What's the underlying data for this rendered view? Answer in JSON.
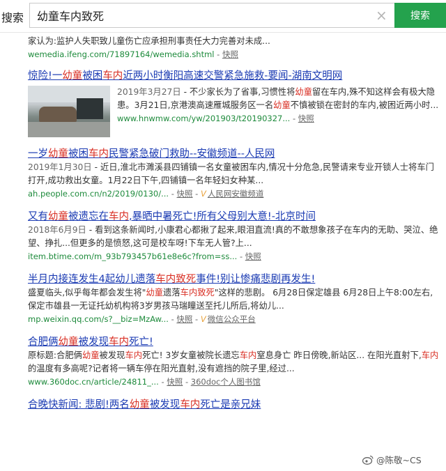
{
  "search": {
    "site_label": "搜索",
    "query": "幼童车内致死",
    "clear_icon": "clear-icon",
    "button_label": "搜索"
  },
  "results": [
    {
      "desc": "家认为:监护人失职致儿童伤亡应承担刑事责任大力完善对未成...",
      "url": "wemedia.ifeng.com/71897164/wemedia.shtml",
      "sep": " - ",
      "snapshot": "快照"
    },
    {
      "title_parts": [
        "惊险!一",
        "幼童",
        "被困",
        "车内",
        "近两小时衡阳高速交警紧急施救-要闻-湖南文明网"
      ],
      "desc_parts": [
        "2019年3月27日",
        " - 不少家长为了省事,习惯性将",
        "幼童",
        "留在车内,殊不知这样会有极大隐患。3月21日,京港澳高速雁城服务区一名",
        "幼童",
        "不慎被锁在密封的车内,被困近两小时..."
      ],
      "url": "www.hnwmw.com/yw/201903/t20190327...",
      "sep": " - ",
      "snapshot": "快照"
    },
    {
      "title_parts": [
        "一岁",
        "幼童",
        "被困",
        "车内",
        "民警紧急破门救助--安徽频道--人民网"
      ],
      "desc_parts": [
        "2019年1月30日",
        " - 近日,淮北市濉溪县四铺镇一名女童被困车内,情况十分危急,民警请来专业开锁人士将车门打开,成功救出女童。1月22日下午,四铺镇一名年轻妇女种某..."
      ],
      "url": "ah.people.com.cn/n2/2019/0130/...",
      "sep": " - ",
      "snapshot": "快照",
      "source_mark": "V",
      "source": "人民网安徽频道"
    },
    {
      "title_parts": [
        "又有",
        "幼童",
        "被遗忘在",
        "车内",
        ",暴晒中暑死亡!所有父母别大意!-北京时间"
      ],
      "desc_parts": [
        "2018年6月9日",
        " - 看到这条新闻时,小康君心都揪了起来,眼泪直流!真的不敢想象孩子在车内的无助、哭泣、绝望、挣扎...但更多的是愤怒,这可是校车呀!下车无人管?上..."
      ],
      "url": "item.btime.com/m_93b793457b61e8e6c?from=ss...",
      "sep": " - ",
      "snapshot": "快照"
    },
    {
      "title_parts": [
        "半月内接连发生4起幼儿遗落",
        "车内致死",
        "事件!别让惨痛悲剧再发生!"
      ],
      "desc_parts": [
        "盛夏临头,似乎每年都会发生将\"",
        "幼童",
        "遗落",
        "车内致死",
        "\"这样的悲剧。 6月28日保定雄县 6月28日上午8:00左右,保定市雄县一无证托幼机构将3岁男孩马瑞瞳送至托儿所后,将幼儿..."
      ],
      "url": "mp.weixin.qq.com/s?__biz=MzAw...",
      "sep": " - ",
      "snapshot": "快照",
      "source_mark": "V",
      "source": "微信公众平台"
    },
    {
      "title_parts": [
        "合肥俩",
        "幼童",
        "被发现",
        "车内",
        "死亡!"
      ],
      "desc_parts": [
        "原标题:合肥俩",
        "幼童",
        "被发现",
        "车内",
        "死亡! 3岁女童被院长遗忘",
        "车内",
        "窒息身亡 昨日傍晚,新站区... 在阳光直射下,",
        "车内",
        "的温度有多高呢?记者将一辆车停在阳光直射,没有遮挡的院子里,经过..."
      ],
      "url": "www.360doc.cn/article/24811_...",
      "sep": " - ",
      "snapshot": "快照",
      "source": "360doc个人图书馆"
    },
    {
      "title_parts": [
        "合晚快新闻: 悲剧!两名",
        "幼童",
        "被发现",
        "车内",
        "死亡是亲兄妹"
      ]
    }
  ],
  "watermark": {
    "icon": "weibo-icon",
    "text": "@陈敬~CS"
  }
}
